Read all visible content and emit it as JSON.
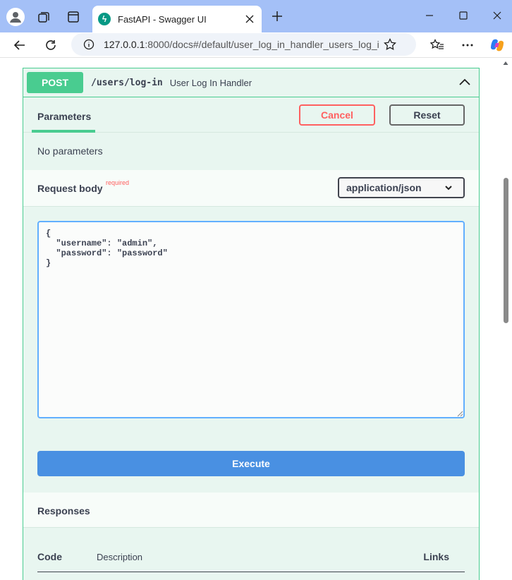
{
  "browser": {
    "tab_title": "FastAPI - Swagger UI",
    "favicon_glyph": "ϟ",
    "url_host": "127.0.0.1",
    "url_rest": ":8000/docs#/default/user_log_in_handler_users_log_i...",
    "icons": [
      "profile-icon",
      "workspaces-icon",
      "tab-actions-icon",
      "close-icon",
      "new-tab-icon",
      "minimize-icon",
      "maximize-icon",
      "back-icon",
      "reload-icon",
      "site-info-icon",
      "favorite-icon",
      "favorites-list-icon",
      "more-icon",
      "copilot-icon"
    ]
  },
  "operation": {
    "method": "POST",
    "path": "/users/log-in",
    "summary": "User Log In Handler"
  },
  "parameters": {
    "tab_label": "Parameters",
    "cancel_label": "Cancel",
    "reset_label": "Reset",
    "empty_text": "No parameters"
  },
  "request_body": {
    "title": "Request body",
    "required_label": "required",
    "content_type": "application/json",
    "editor_value": "{\n  \"username\": \"admin\",\n  \"password\": \"password\"\n}",
    "execute_label": "Execute"
  },
  "responses": {
    "title": "Responses",
    "columns": [
      "Code",
      "Description",
      "Links"
    ]
  },
  "colors": {
    "post_green": "#49cc90",
    "cancel_red": "#ff6060",
    "execute_blue": "#4990e2",
    "tabbar": "#a4c0f7"
  }
}
